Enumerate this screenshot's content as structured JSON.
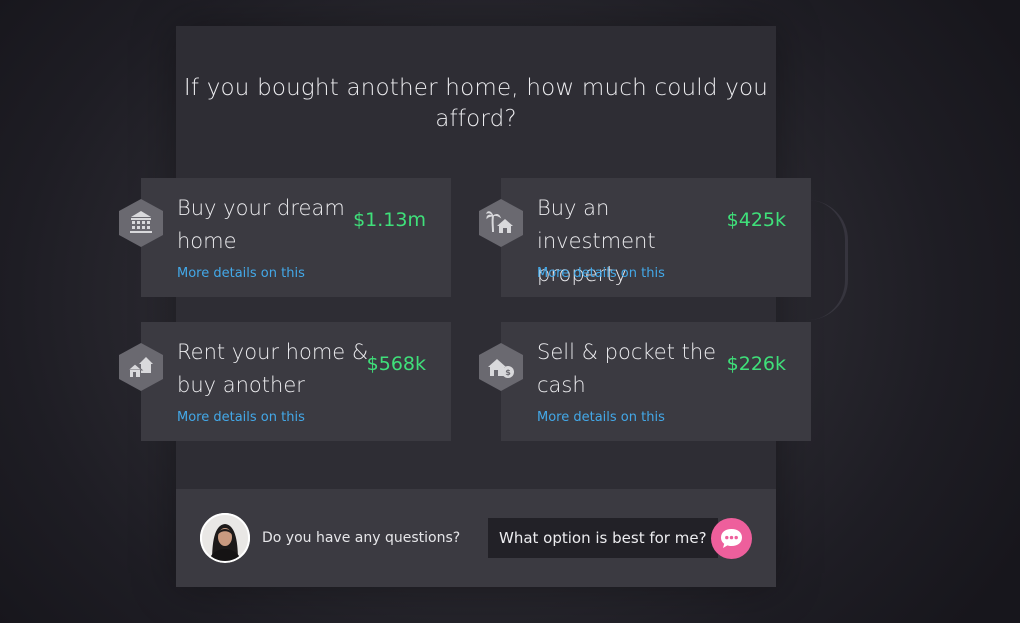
{
  "headline": "If you bought another home, how much could you afford?",
  "options": [
    {
      "title": "Buy your dream home",
      "price": "$1.13m",
      "link": "More details on this",
      "icon": "building-icon"
    },
    {
      "title": "Buy an investment property",
      "price": "$425k",
      "link": "More details on this",
      "icon": "beach-house-icon"
    },
    {
      "title": "Rent your home & buy another",
      "price": "$568k",
      "link": "More details on this",
      "icon": "two-houses-icon"
    },
    {
      "title": "Sell & pocket the cash",
      "price": "$226k",
      "link": "More details on this",
      "icon": "house-dollar-icon"
    }
  ],
  "footer": {
    "question": "Do you have any questions?",
    "ask_label": "What option is best for me?",
    "chat_icon": "chat-bubble-icon"
  },
  "colors": {
    "price": "#3fe07a",
    "link": "#43a8e8",
    "chat_button": "#ee5f9c",
    "panel": "#2e2d34",
    "card": "#3b3a41"
  }
}
